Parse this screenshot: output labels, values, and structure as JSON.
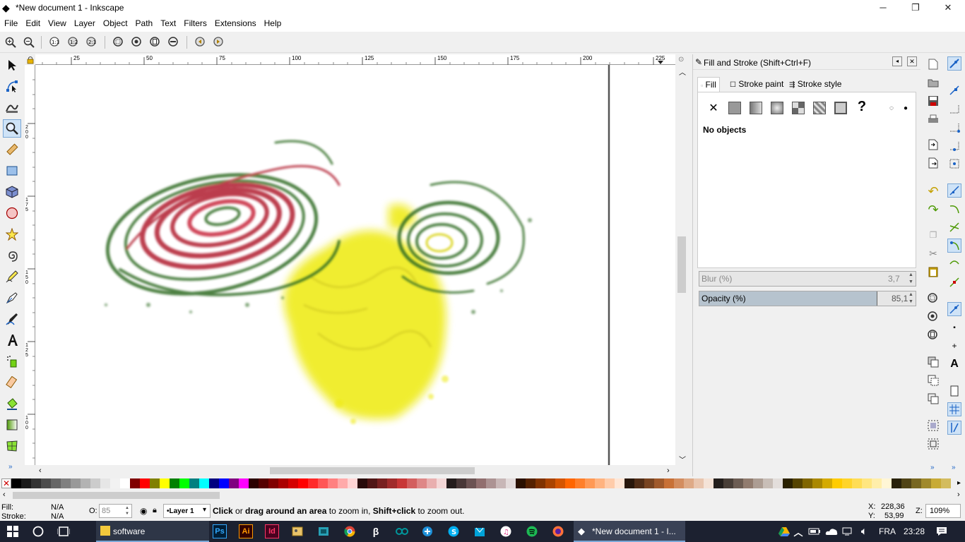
{
  "window": {
    "title": "*New document 1 - Inkscape",
    "min": "─",
    "max": "❐",
    "close": "✕"
  },
  "menu": [
    "File",
    "Edit",
    "View",
    "Layer",
    "Object",
    "Path",
    "Text",
    "Filters",
    "Extensions",
    "Help"
  ],
  "ruler": {
    "h_ticks": [
      "25",
      "50",
      "75",
      "100",
      "125",
      "150",
      "175",
      "200",
      "225"
    ],
    "v_ticks": [
      "200",
      "175",
      "150",
      "125",
      "100"
    ]
  },
  "panel": {
    "title": "Fill and Stroke (Shift+Ctrl+F)",
    "tabs": [
      "Fill",
      "Stroke paint",
      "Stroke style"
    ],
    "message": "No objects",
    "blur_label": "Blur (%)",
    "blur_value": "3,7",
    "opacity_label": "Opacity (%)",
    "opacity_value": "85,1",
    "opacity_fraction": 0.85
  },
  "palette": [
    "#000000",
    "#1a1a1a",
    "#333333",
    "#4d4d4d",
    "#666666",
    "#808080",
    "#999999",
    "#b3b3b3",
    "#cccccc",
    "#e6e6e6",
    "#f2f2f2",
    "#ffffff",
    "#800000",
    "#ff0000",
    "#808000",
    "#ffff00",
    "#008000",
    "#00ff00",
    "#008080",
    "#00ffff",
    "#000080",
    "#0000ff",
    "#800080",
    "#ff00ff",
    "#2b0000",
    "#550000",
    "#800000",
    "#aa0000",
    "#d40000",
    "#ff0000",
    "#ff2a2a",
    "#ff5555",
    "#ff8080",
    "#ffaaaa",
    "#ffd5d5",
    "#280b0b",
    "#501616",
    "#782121",
    "#a02c2c",
    "#c83737",
    "#d35f5f",
    "#de8787",
    "#e9afaf",
    "#f4d7d7",
    "#241c1c",
    "#483737",
    "#6c5353",
    "#916f6f",
    "#ac9393",
    "#c8b7b7",
    "#e3dbdb",
    "#2b1100",
    "#552200",
    "#803300",
    "#aa4400",
    "#d45500",
    "#ff6600",
    "#ff7f2a",
    "#ff9955",
    "#ffb380",
    "#ffccaa",
    "#ffe6d5",
    "#28170b",
    "#502d16",
    "#784421",
    "#a05a2c",
    "#c87137",
    "#d38d5f",
    "#deaa87",
    "#e9c6af",
    "#f4e3d7",
    "#241f1c",
    "#483e37",
    "#6c5d53",
    "#917c6f",
    "#ac9d93",
    "#c8beb7",
    "#e3dedb",
    "#2b2200",
    "#554400",
    "#806600",
    "#aa8800",
    "#d4aa00",
    "#ffcc00",
    "#ffd42a",
    "#ffdd55",
    "#ffe680",
    "#ffeeaa",
    "#fff6d5",
    "#28220b",
    "#504416",
    "#786721",
    "#a0892c",
    "#c8ab37",
    "#d3bc5f"
  ],
  "status": {
    "fill_label": "Fill:",
    "fill_value": "N/A",
    "stroke_label": "Stroke:",
    "stroke_value": "N/A",
    "o_label": "O:",
    "o_value": "85",
    "layer": "•Layer 1",
    "msg_b1": "Click",
    "msg_1": " or ",
    "msg_b2": "drag around an area",
    "msg_2": " to zoom in, ",
    "msg_b3": "Shift+click",
    "msg_3": " to zoom out.",
    "x_label": "X:",
    "x_value": "228,36",
    "y_label": "Y:",
    "y_value": "53,99",
    "z_label": "Z:",
    "zoom": "109%"
  },
  "taskbar": {
    "folder": "software",
    "inkscape": "*New document 1 - I...",
    "lang": "FRA",
    "time": "23:28",
    "icons": [
      "Ps",
      "Ai",
      "Id"
    ]
  },
  "icons": {
    "tools": [
      "selector-icon",
      "node-icon",
      "tweak-icon",
      "zoom-icon",
      "measure-icon",
      "rect-icon",
      "3dbox-icon",
      "ellipse-icon",
      "star-icon",
      "spiral-icon",
      "pencil-icon",
      "pen-icon",
      "calligraphy-icon",
      "text-icon",
      "spray-icon",
      "eraser-icon",
      "bucket-icon",
      "gradient-icon",
      "mesh-icon"
    ]
  }
}
